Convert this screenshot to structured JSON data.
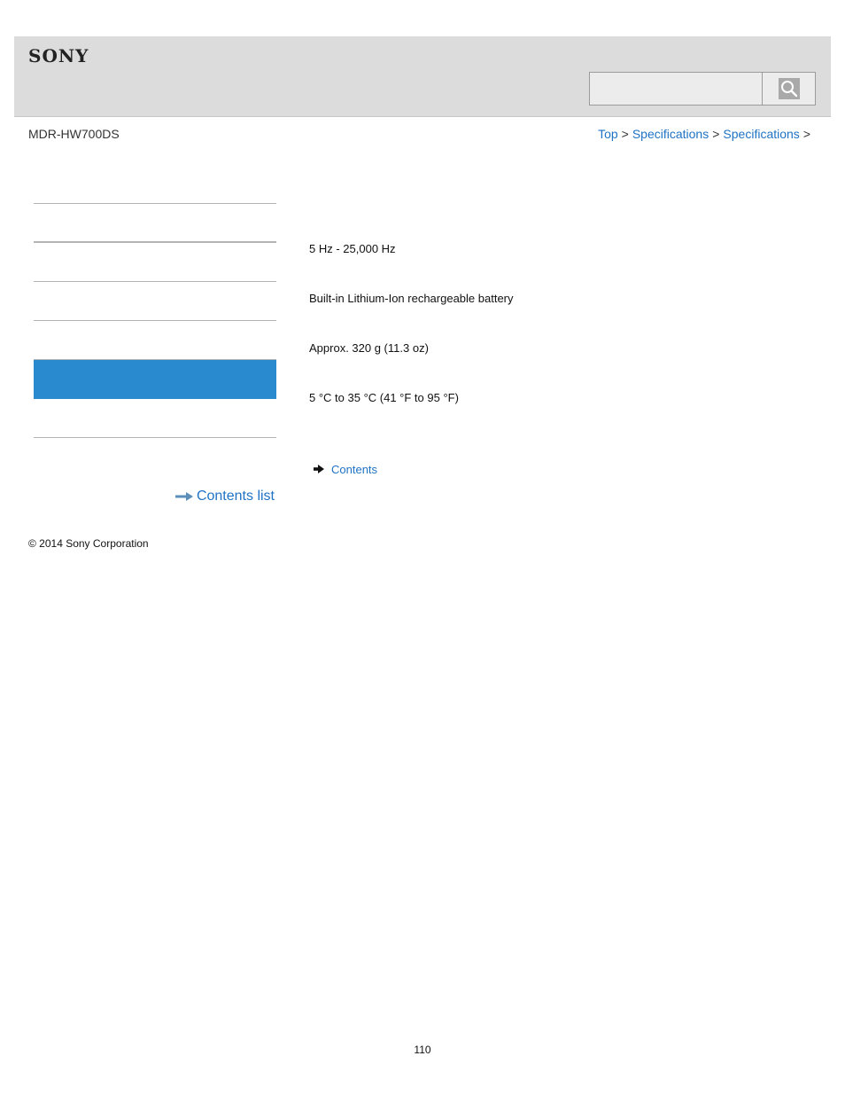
{
  "header": {
    "brand": "SONY",
    "search": {
      "placeholder": "",
      "value": ""
    }
  },
  "model": "MDR-HW700DS",
  "breadcrumb": {
    "items": [
      "Top",
      "Specifications",
      "Specifications"
    ],
    "separator": ">"
  },
  "sidebar": {
    "items": [
      {
        "label": ""
      },
      {
        "label": ""
      },
      {
        "label": ""
      },
      {
        "label": ""
      },
      {
        "label": ""
      },
      {
        "label": "",
        "active": true
      },
      {
        "label": ""
      }
    ],
    "contents_list_label": "Contents list"
  },
  "specs": {
    "rows": [
      {
        "value": ""
      },
      {
        "value": "5 Hz - 25,000 Hz"
      },
      {
        "value": "Built-in Lithium-Ion rechargeable battery"
      },
      {
        "value": "Approx. 320 g (11.3 oz)"
      },
      {
        "value": "5 °C to 35 °C (41 °F to 95 °F)"
      }
    ]
  },
  "related_link": {
    "label": "Contents"
  },
  "footer": {
    "copyright": "© 2014 Sony Corporation",
    "page_number": "110"
  },
  "colors": {
    "link": "#1f73c4",
    "active_nav": "#2a8ad0",
    "header_bg": "#dcdcdc"
  },
  "icons": {
    "search": "magnifier-icon",
    "contents_list": "arrow-right-icon",
    "related": "arrow-right-icon"
  }
}
